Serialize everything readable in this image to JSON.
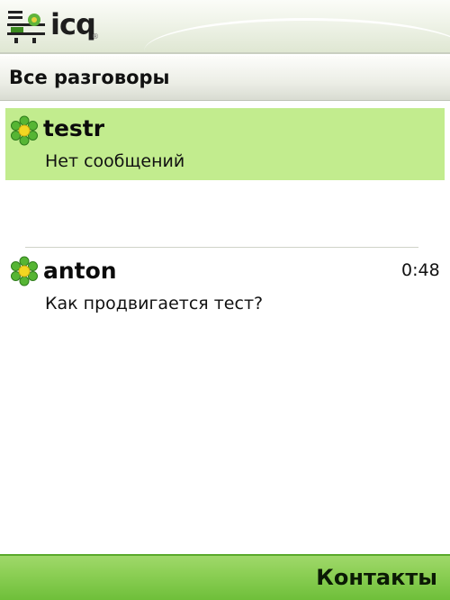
{
  "app": {
    "name": "icq",
    "trademark": "®"
  },
  "header": {
    "title": "Все разговоры"
  },
  "conversations": [
    {
      "name": "testr",
      "message": "Нет сообщений",
      "time": "",
      "selected": true,
      "icon": "icq-flower-icon"
    },
    {
      "name": "anton",
      "message": "Как продвигается тест?",
      "time": "0:48",
      "selected": false,
      "icon": "icq-flower-icon"
    }
  ],
  "softkeys": {
    "right": "Контакты"
  },
  "colors": {
    "selection": "#c2ec8e",
    "softkey_bar": "#8ccf55",
    "flower_green": "#56b534",
    "flower_center": "#f2d622"
  }
}
